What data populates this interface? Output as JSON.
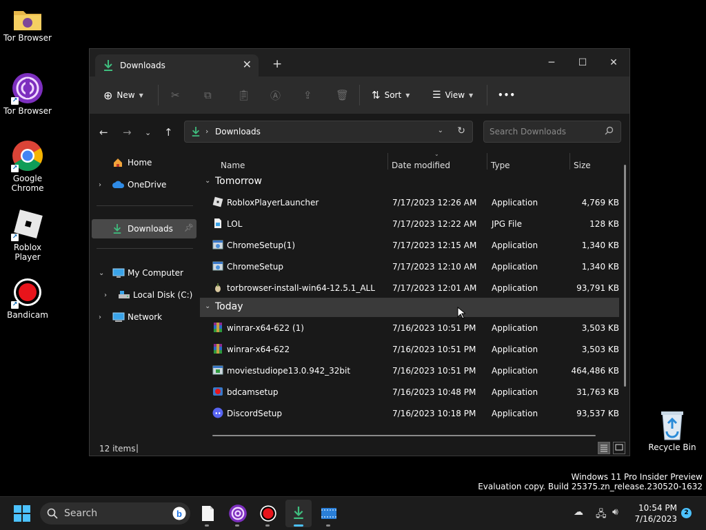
{
  "desktop": {
    "icons": [
      {
        "label": "Tor Browser",
        "icon": "folder-tor-icon"
      },
      {
        "label": "Tor Browser",
        "icon": "tor-browser-icon"
      },
      {
        "label": "Google Chrome",
        "icon": "chrome-icon"
      },
      {
        "label": "Roblox Player",
        "icon": "roblox-icon"
      },
      {
        "label": "Bandicam",
        "icon": "bandicam-icon"
      },
      {
        "label": "Recycle Bin",
        "icon": "recycle-bin-icon"
      }
    ]
  },
  "explorer": {
    "tab_title": "Downloads",
    "toolbar": {
      "new_label": "New",
      "sort_label": "Sort",
      "view_label": "View",
      "more_label": "•••"
    },
    "breadcrumb": "Downloads",
    "search_placeholder": "Search Downloads",
    "nav": {
      "home": "Home",
      "onedrive": "OneDrive",
      "downloads": "Downloads",
      "my_computer": "My Computer",
      "local_disk": "Local Disk (C:)",
      "network": "Network"
    },
    "columns": {
      "name": "Name",
      "date": "Date modified",
      "type": "Type",
      "size": "Size"
    },
    "groups": [
      {
        "title": "Tomorrow",
        "files": [
          {
            "name": "RobloxPlayerLauncher",
            "date": "7/17/2023 12:26 AM",
            "type": "Application",
            "size": "4,769 KB",
            "icon": "roblox-file-icon"
          },
          {
            "name": "LOL",
            "date": "7/17/2023 12:22 AM",
            "type": "JPG File",
            "size": "128 KB",
            "icon": "image-file-icon"
          },
          {
            "name": "ChromeSetup(1)",
            "date": "7/17/2023 12:15 AM",
            "type": "Application",
            "size": "1,340 KB",
            "icon": "installer-icon"
          },
          {
            "name": "ChromeSetup",
            "date": "7/17/2023 12:10 AM",
            "type": "Application",
            "size": "1,340 KB",
            "icon": "installer-icon"
          },
          {
            "name": "torbrowser-install-win64-12.5.1_ALL",
            "date": "7/17/2023 12:01 AM",
            "type": "Application",
            "size": "93,791 KB",
            "icon": "tor-onion-icon"
          }
        ]
      },
      {
        "title": "Today",
        "files": [
          {
            "name": "winrar-x64-622 (1)",
            "date": "7/16/2023 10:51 PM",
            "type": "Application",
            "size": "3,503 KB",
            "icon": "winrar-icon"
          },
          {
            "name": "winrar-x64-622",
            "date": "7/16/2023 10:51 PM",
            "type": "Application",
            "size": "3,503 KB",
            "icon": "winrar-icon"
          },
          {
            "name": "moviestudiope13.0.942_32bit",
            "date": "7/16/2023 10:51 PM",
            "type": "Application",
            "size": "464,486 KB",
            "icon": "installer-icon"
          },
          {
            "name": "bdcamsetup",
            "date": "7/16/2023 10:48 PM",
            "type": "Application",
            "size": "31,763 KB",
            "icon": "bandicam-file-icon"
          },
          {
            "name": "DiscordSetup",
            "date": "7/16/2023 10:18 PM",
            "type": "Application",
            "size": "93,537 KB",
            "icon": "discord-icon"
          }
        ]
      }
    ],
    "status": {
      "count": "12 items"
    }
  },
  "watermark": {
    "line1": "Windows 11 Pro Insider Preview",
    "line2": "Evaluation copy. Build 25375.zn_release.230520-1632"
  },
  "taskbar": {
    "search_label": "Search",
    "time": "10:54 PM",
    "date": "7/16/2023",
    "notification_count": "2"
  },
  "colors": {
    "accent": "#4cc2ff",
    "download_green": "#3fbf7f"
  }
}
